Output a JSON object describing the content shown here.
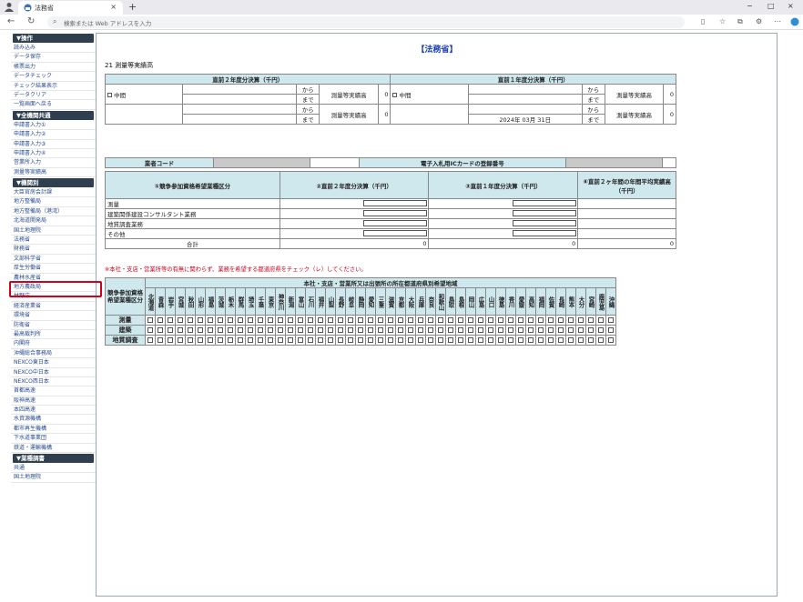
{
  "browser": {
    "tab_title": "法務省",
    "tab_close": "×",
    "new_tab": "+",
    "address_placeholder": "検索または Web アドレスを入力",
    "win_min": "−",
    "win_max": "□",
    "win_close": "×"
  },
  "sidebar": {
    "groups": [
      {
        "header": "▼操作",
        "items": [
          "読み込み",
          "データ保存",
          "帳票出力",
          "データチェック",
          "チェック結果表示",
          "データクリア",
          "一覧画面へ戻る"
        ]
      },
      {
        "header": "▼全機関共通",
        "items": [
          "申請書入力①",
          "申請書入力②",
          "申請書入力③",
          "申請書入力④",
          "営業所入力",
          "測量等実績高"
        ]
      },
      {
        "header": "▼機関別",
        "items": [
          "大臣官房会計課",
          "地方整備局",
          "地方整備局（港湾）",
          "北海道開発局",
          "国土地理院",
          "法務省",
          "財務省",
          "文部科学省",
          "厚生労働省",
          "農林水産省",
          "地方農政局",
          "林野庁",
          "経済産業省",
          "環境省",
          "防衛省",
          "最高裁判所",
          "内閣府",
          "沖縄総合事務局",
          "NEXCO東日本",
          "NEXCO中日本",
          "NEXCO西日本",
          "首都高速",
          "阪神高速",
          "本四高速",
          "水資源機構",
          "都市再生機構",
          "下水道事業団",
          "鉄道・運輸機構"
        ]
      },
      {
        "header": "▼業種調書",
        "items": [
          "共通",
          "国土地理院"
        ]
      }
    ]
  },
  "main": {
    "page_title": "【法務省】",
    "section_title": "21 測量等実績高",
    "t1": {
      "h_prev2": "直前２年度分決算（千円）",
      "h_prev1": "直前１年度分決算（千円）",
      "chuukan": "中間",
      "kara": "から",
      "made": "まで",
      "label": "測量等実績高",
      "zero": "0",
      "date": "2024年 03月 31日"
    },
    "t2": {
      "code_label": "業者コード",
      "ic_label": "電子入札用ICカードの登録番号"
    },
    "t3": {
      "h1": "①競争参加資格希望業種区分",
      "h2": "②直前２年度分決算（千円）",
      "h3": "③直前１年度分決算（千円）",
      "h4": "④直前２ヶ年間の年間平均実績高（千円）",
      "rows": [
        "測量",
        "建築関係建設コンサルタント業務",
        "地質調査業務",
        "その他"
      ],
      "total_label": "合計",
      "zero": "0"
    },
    "note": "※本社・支店・営業所等の有無に関わらず、業務を希望する都道府県をチェック（レ）してください。",
    "t4": {
      "corner": "競争参加資格希望業種区分",
      "title": "本社・支店・営業所又は出張所の所在都道府県別希望地域",
      "prefs": [
        "北海道",
        "青森",
        "岩手",
        "宮城",
        "秋田",
        "山形",
        "福島",
        "茨城",
        "栃木",
        "群馬",
        "埼玉",
        "千葉",
        "東京",
        "神奈川",
        "新潟",
        "富山",
        "石川",
        "福井",
        "山梨",
        "長野",
        "岐阜",
        "静岡",
        "愛知",
        "三重",
        "滋賀",
        "京都",
        "大阪",
        "兵庫",
        "奈良",
        "和歌山",
        "鳥取",
        "島根",
        "岡山",
        "広島",
        "山口",
        "徳島",
        "香川",
        "愛媛",
        "高知",
        "福岡",
        "佐賀",
        "長崎",
        "熊本",
        "大分",
        "宮崎",
        "鹿児島",
        "沖縄"
      ],
      "rows": [
        "測量",
        "建築",
        "地質調査"
      ]
    }
  }
}
